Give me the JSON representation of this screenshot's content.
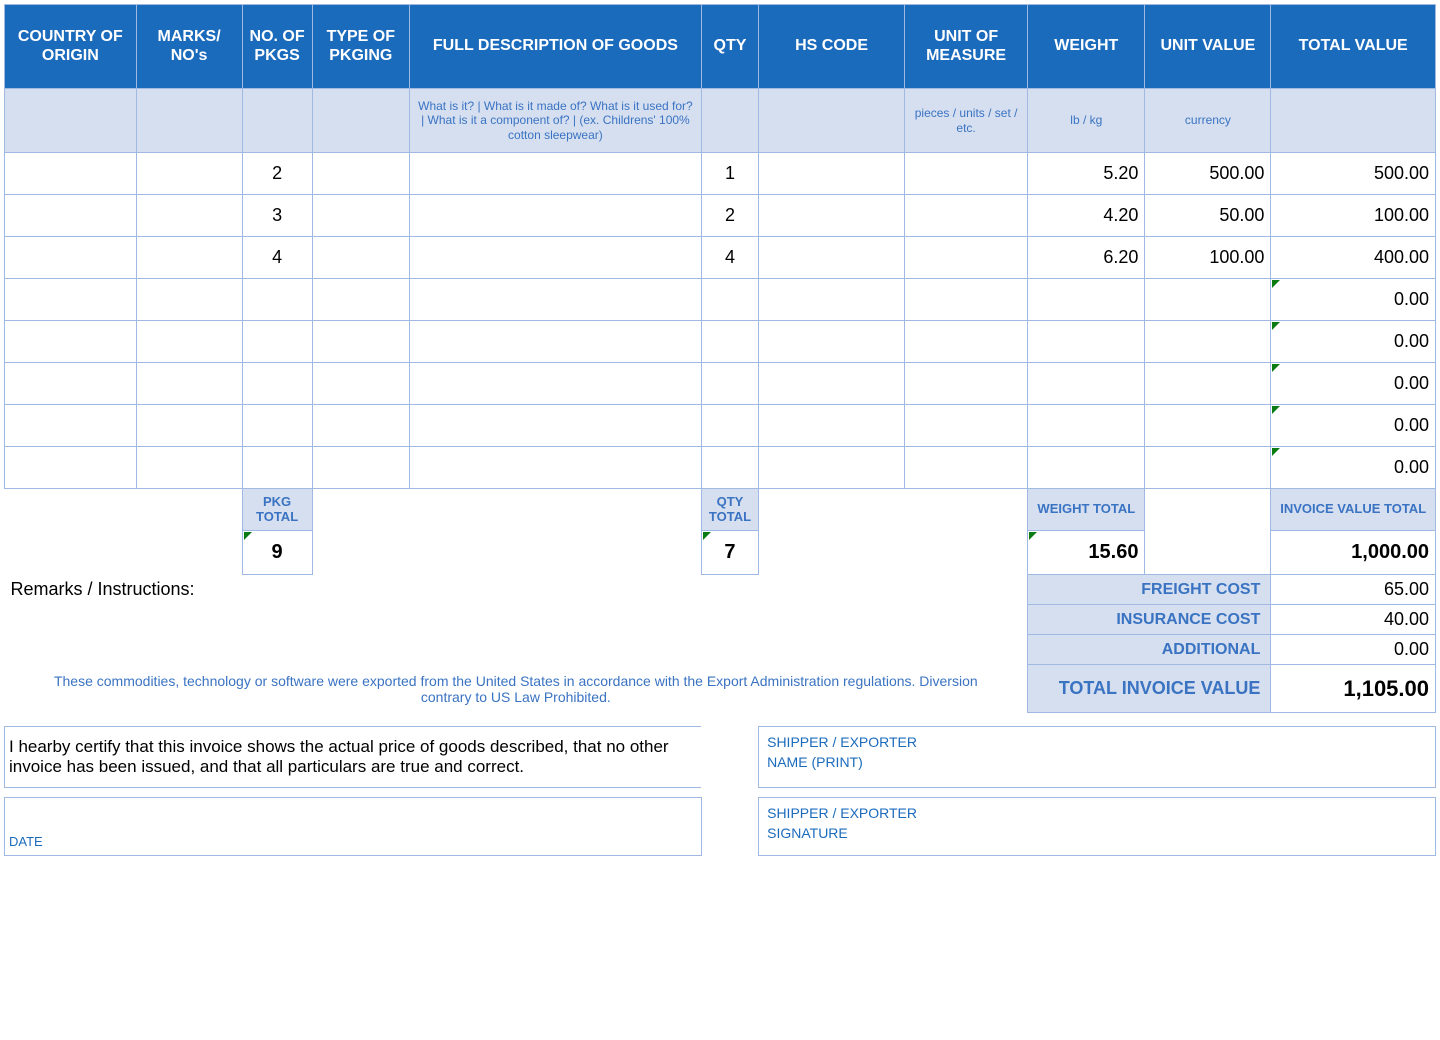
{
  "headers": {
    "country": "COUNTRY OF ORIGIN",
    "marks": "MARKS/ NO's",
    "pkgs": "NO. OF PKGS",
    "pkging": "TYPE OF PKGING",
    "desc": "FULL DESCRIPTION OF GOODS",
    "qty": "QTY",
    "hs": "HS CODE",
    "uom": "UNIT OF MEASURE",
    "weight": "WEIGHT",
    "unitval": "UNIT VALUE",
    "totalval": "TOTAL VALUE"
  },
  "hints": {
    "desc": "What is it? | What is it made of? What is it used for? | What is it a component of? | (ex. Childrens' 100% cotton sleepwear)",
    "uom": "pieces / units / set / etc.",
    "weight": "lb / kg",
    "unitval": "currency"
  },
  "rows": [
    {
      "pkgs": "2",
      "qty": "1",
      "weight": "5.20",
      "unitval": "500.00",
      "totalval": "500.00"
    },
    {
      "pkgs": "3",
      "qty": "2",
      "weight": "4.20",
      "unitval": "50.00",
      "totalval": "100.00"
    },
    {
      "pkgs": "4",
      "qty": "4",
      "weight": "6.20",
      "unitval": "100.00",
      "totalval": "400.00"
    },
    {
      "totalval": "0.00"
    },
    {
      "totalval": "0.00"
    },
    {
      "totalval": "0.00"
    },
    {
      "totalval": "0.00"
    },
    {
      "totalval": "0.00"
    }
  ],
  "subheads": {
    "pkg": "PKG TOTAL",
    "qty": "QTY TOTAL",
    "weight": "WEIGHT TOTAL",
    "invoice": "INVOICE VALUE TOTAL"
  },
  "totals": {
    "pkg": "9",
    "qty": "7",
    "weight": "15.60",
    "invoice": "1,000.00"
  },
  "remarks_label": "Remarks / Instructions:",
  "costs": {
    "freight_label": "FREIGHT COST",
    "freight": "65.00",
    "insurance_label": "INSURANCE COST",
    "insurance": "40.00",
    "additional_label": "ADDITIONAL",
    "additional": "0.00",
    "total_label": "TOTAL INVOICE VALUE",
    "total": "1,105.00"
  },
  "disclaimer": "These commodities, technology or software were exported from the United States in accordance with the Export Administration regulations.  Diversion contrary to US Law Prohibited.",
  "cert": "I hearby certify that this invoice shows the actual price of goods described, that no other invoice has been issued, and that all particulars are true and correct.",
  "sig": {
    "name1": "SHIPPER / EXPORTER",
    "name2": "NAME (PRINT)",
    "sig1": "SHIPPER / EXPORTER",
    "sig2": "SIGNATURE",
    "date": "DATE"
  }
}
